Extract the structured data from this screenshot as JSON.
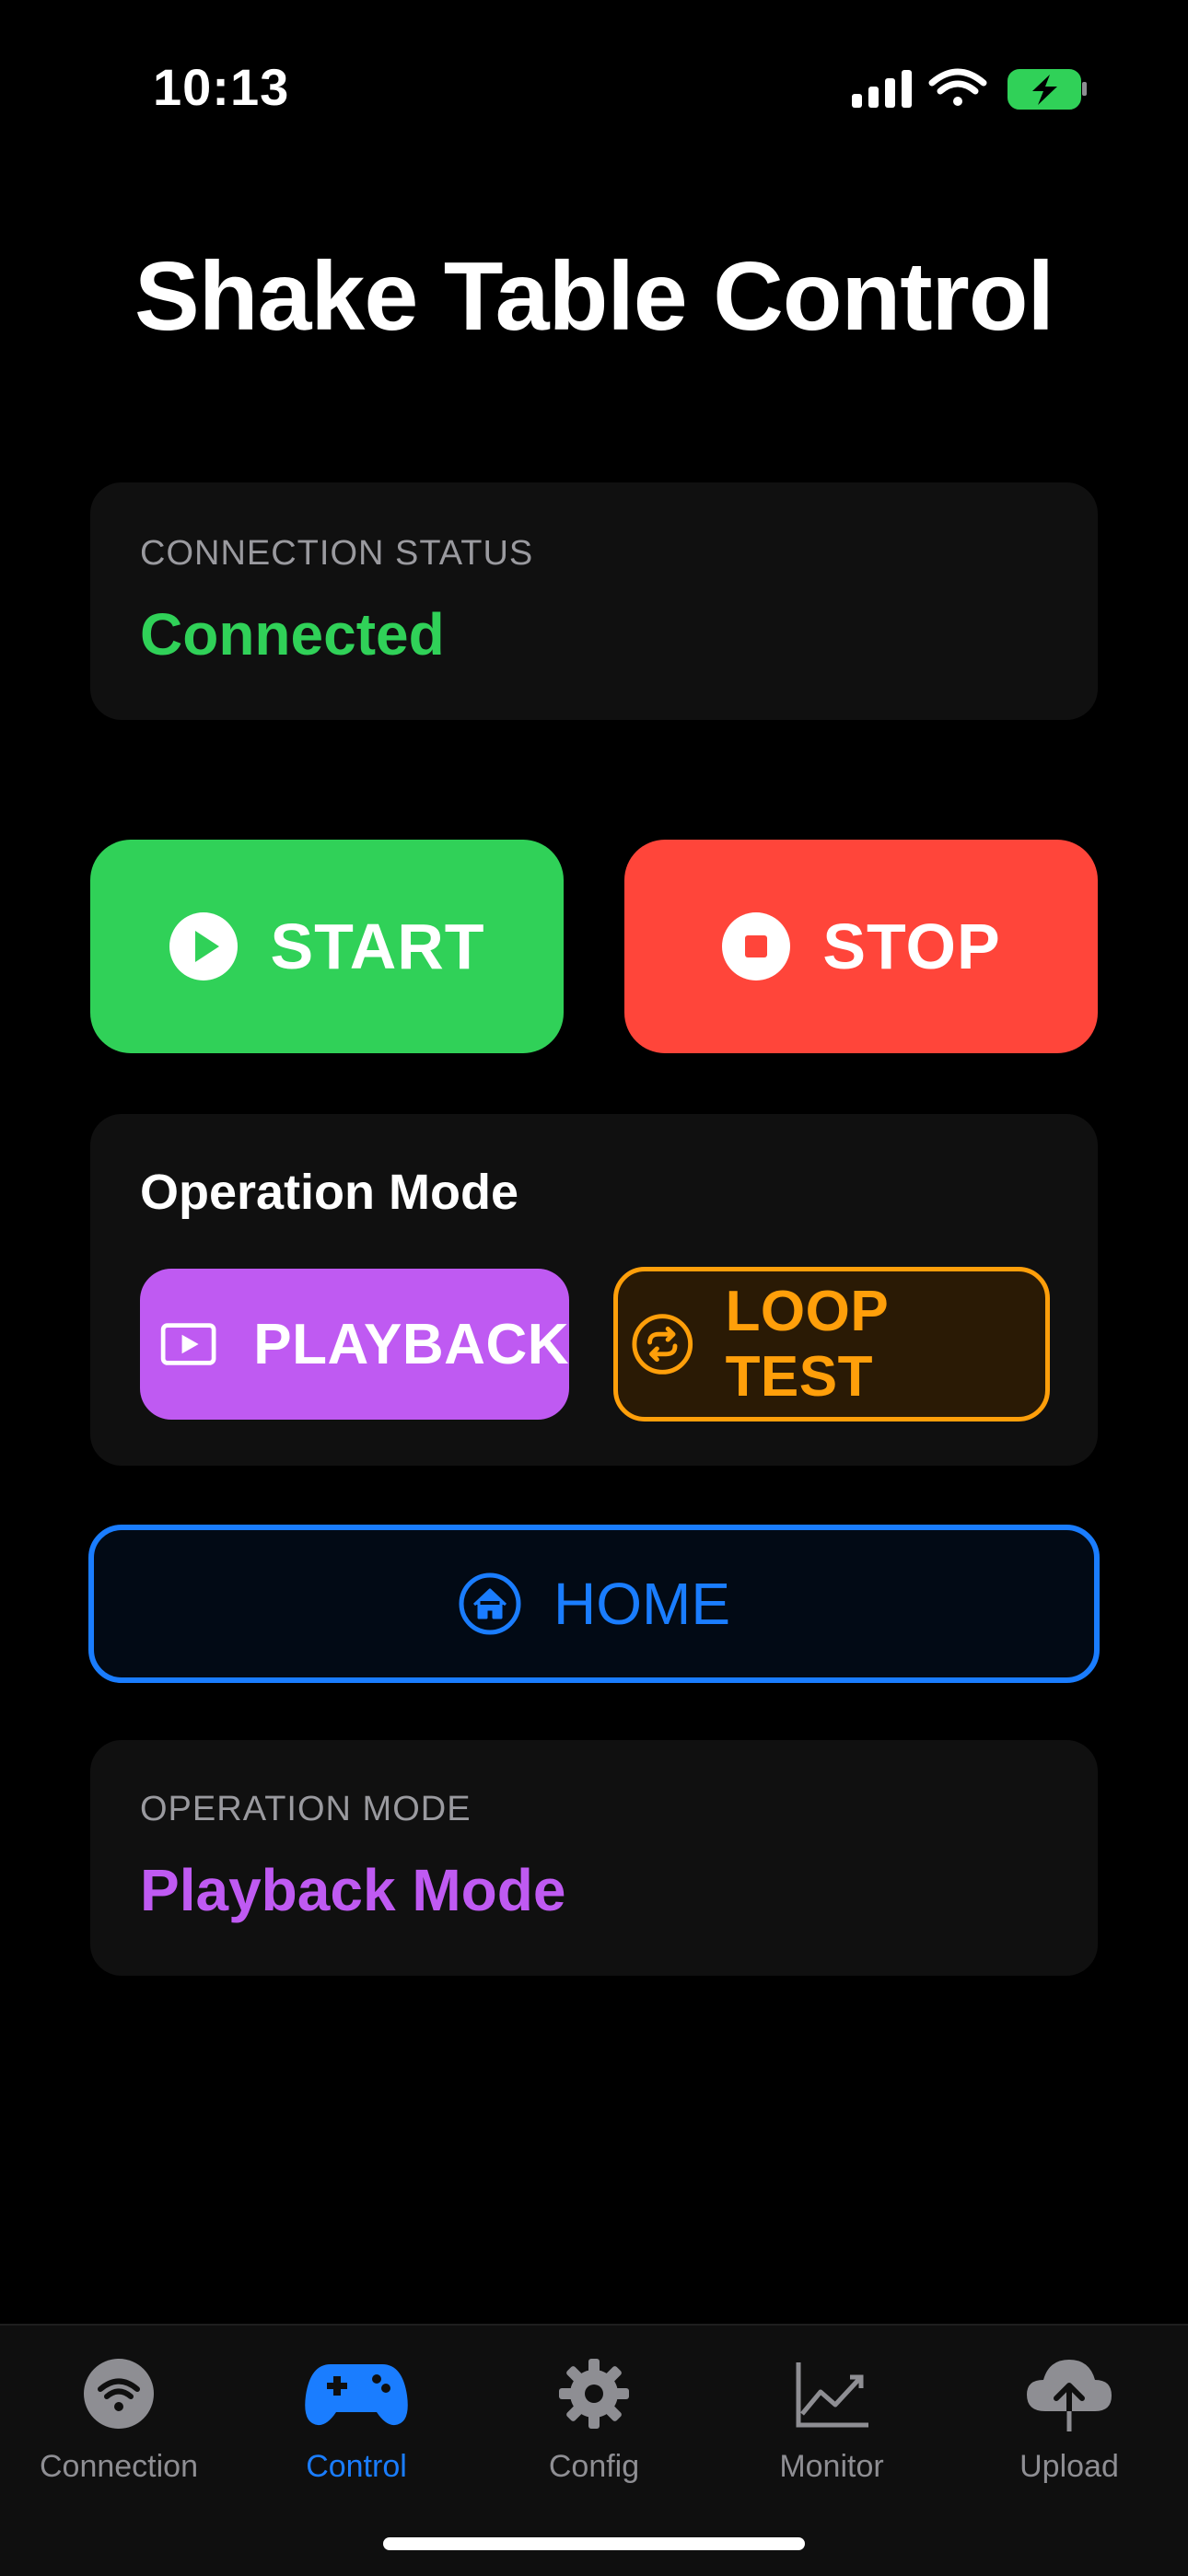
{
  "status_bar": {
    "time": "10:13"
  },
  "page_title": "Shake Table Control",
  "connection_card": {
    "label": "CONNECTION STATUS",
    "value": "Connected",
    "value_color": "#30d158"
  },
  "controls": {
    "start_label": "START",
    "stop_label": "STOP",
    "start_color": "#30d158",
    "stop_color": "#ff453a"
  },
  "operation_mode_panel": {
    "title": "Operation Mode",
    "playback_label": "PLAYBACK",
    "loop_test_label": "LOOP TEST",
    "playback_color": "#bf5af2",
    "loop_color": "#ff9f0a"
  },
  "home": {
    "label": "HOME",
    "color": "#1a7dff"
  },
  "mode_card": {
    "label": "OPERATION MODE",
    "value": "Playback Mode",
    "value_color": "#bf5af2"
  },
  "tab_bar": {
    "active": "Control",
    "tabs": [
      {
        "label": "Connection",
        "icon": "wifi-circle-icon"
      },
      {
        "label": "Control",
        "icon": "gamecontroller-icon"
      },
      {
        "label": "Config",
        "icon": "gear-icon"
      },
      {
        "label": "Monitor",
        "icon": "chart-line-icon"
      },
      {
        "label": "Upload",
        "icon": "cloud-upload-icon"
      }
    ]
  }
}
